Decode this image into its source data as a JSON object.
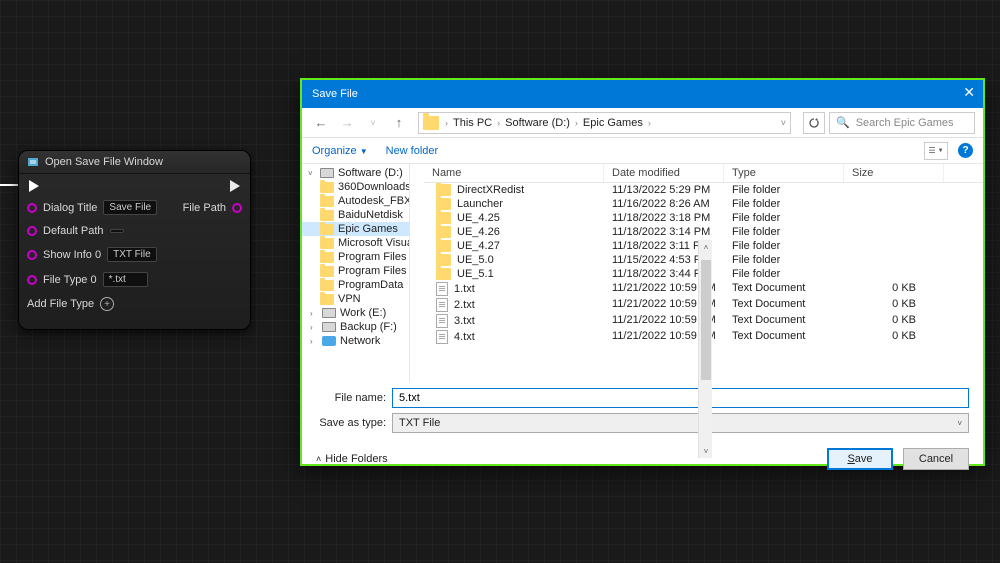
{
  "node": {
    "title": "Open Save File Window",
    "rows": {
      "dialog_title_label": "Dialog Title",
      "dialog_title_value": "Save File",
      "file_path_label": "File Path",
      "default_path_label": "Default Path",
      "default_path_value": "",
      "show_info_label": "Show Info 0",
      "show_info_value": "TXT File",
      "file_type_label": "File Type 0",
      "file_type_value": "*.txt"
    },
    "add_file_type_label": "Add File Type"
  },
  "dialog": {
    "title": "Save File",
    "nav": {
      "breadcrumb": [
        "This PC",
        "Software (D:)",
        "Epic Games"
      ],
      "search_placeholder": "Search Epic Games"
    },
    "toolbar": {
      "organize": "Organize",
      "new_folder": "New folder"
    },
    "tree": [
      {
        "label": "Software (D:)",
        "type": "drive",
        "root": true,
        "expanded": true
      },
      {
        "label": "360Downloads",
        "type": "folder"
      },
      {
        "label": "Autodesk_FBX_",
        "type": "folder"
      },
      {
        "label": "BaiduNetdisk",
        "type": "folder"
      },
      {
        "label": "Epic Games",
        "type": "folder",
        "selected": true
      },
      {
        "label": "Microsoft Visua",
        "type": "folder"
      },
      {
        "label": "Program Files",
        "type": "folder"
      },
      {
        "label": "Program Files (",
        "type": "folder"
      },
      {
        "label": "ProgramData",
        "type": "folder"
      },
      {
        "label": "VPN",
        "type": "folder"
      },
      {
        "label": "Work (E:)",
        "type": "drive",
        "drive": true
      },
      {
        "label": "Backup (F:)",
        "type": "drive",
        "drive": true
      },
      {
        "label": "Network",
        "type": "network",
        "net": true
      }
    ],
    "columns": {
      "name": "Name",
      "date": "Date modified",
      "type": "Type",
      "size": "Size"
    },
    "files": [
      {
        "name": "DirectXRedist",
        "date": "11/13/2022 5:29 PM",
        "type": "File folder",
        "size": "",
        "icon": "folder"
      },
      {
        "name": "Launcher",
        "date": "11/16/2022 8:26 AM",
        "type": "File folder",
        "size": "",
        "icon": "folder"
      },
      {
        "name": "UE_4.25",
        "date": "11/18/2022 3:18 PM",
        "type": "File folder",
        "size": "",
        "icon": "folder"
      },
      {
        "name": "UE_4.26",
        "date": "11/18/2022 3:14 PM",
        "type": "File folder",
        "size": "",
        "icon": "folder"
      },
      {
        "name": "UE_4.27",
        "date": "11/18/2022 3:11 PM",
        "type": "File folder",
        "size": "",
        "icon": "folder"
      },
      {
        "name": "UE_5.0",
        "date": "11/15/2022 4:53 PM",
        "type": "File folder",
        "size": "",
        "icon": "folder"
      },
      {
        "name": "UE_5.1",
        "date": "11/18/2022 3:44 PM",
        "type": "File folder",
        "size": "",
        "icon": "folder"
      },
      {
        "name": "1.txt",
        "date": "11/21/2022 10:59 AM",
        "type": "Text Document",
        "size": "0 KB",
        "icon": "txt"
      },
      {
        "name": "2.txt",
        "date": "11/21/2022 10:59 AM",
        "type": "Text Document",
        "size": "0 KB",
        "icon": "txt"
      },
      {
        "name": "3.txt",
        "date": "11/21/2022 10:59 AM",
        "type": "Text Document",
        "size": "0 KB",
        "icon": "txt"
      },
      {
        "name": "4.txt",
        "date": "11/21/2022 10:59 AM",
        "type": "Text Document",
        "size": "0 KB",
        "icon": "txt"
      }
    ],
    "form": {
      "filename_label": "File name:",
      "filename_value": "5.txt",
      "saveas_label": "Save as type:",
      "saveas_value": "TXT File"
    },
    "bottom": {
      "hide_folders": "Hide Folders",
      "save": "Save",
      "cancel": "Cancel"
    }
  }
}
